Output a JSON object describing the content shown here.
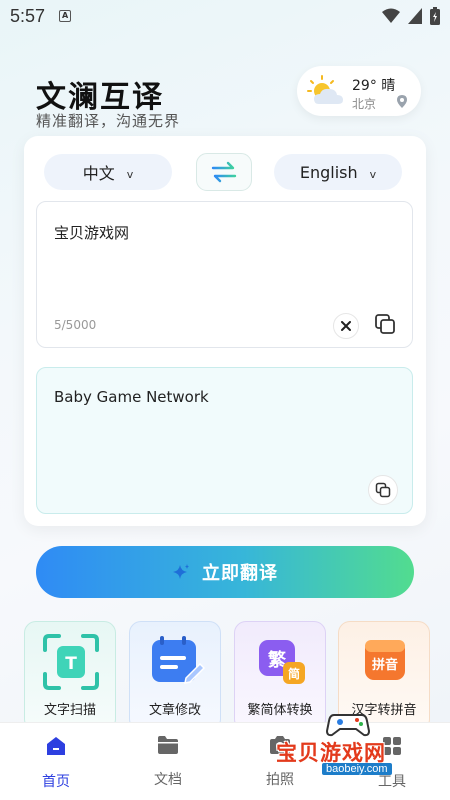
{
  "status_bar": {
    "time": "5:57",
    "app_icon_letter": "A"
  },
  "header": {
    "title": "文澜互译",
    "subtitle": "精准翻译，沟通无界"
  },
  "weather": {
    "temp": "29° 晴",
    "city": "北京",
    "icon": "sun-cloud-icon"
  },
  "translator": {
    "source_lang": "中文",
    "target_lang": "English",
    "input_text": "宝贝游戏网",
    "char_count": "5/5000",
    "output_text": "Baby Game Network"
  },
  "translate_button": {
    "label": "立即翻译"
  },
  "tools": [
    {
      "label": "文字扫描",
      "icon": "text-scan-icon"
    },
    {
      "label": "文章修改",
      "icon": "article-edit-icon"
    },
    {
      "label": "繁简体转换",
      "icon": "trad-simp-icon"
    },
    {
      "label": "汉字转拼音",
      "icon": "pinyin-icon"
    }
  ],
  "tool_icon_text": {
    "scan": "T",
    "trad": "繁",
    "simp": "简",
    "pinyin": "拼音"
  },
  "bottom_nav": [
    {
      "label": "首页",
      "active": true
    },
    {
      "label": "文档",
      "active": false
    },
    {
      "label": "拍照",
      "active": false
    },
    {
      "label": "工具",
      "active": false
    }
  ],
  "watermark": {
    "title": "宝贝游戏网",
    "url": "baobeiy.com"
  },
  "colors": {
    "accent": "#2d3fe0",
    "gradient_start": "#2f8bf5",
    "gradient_end": "#52dc8f"
  }
}
